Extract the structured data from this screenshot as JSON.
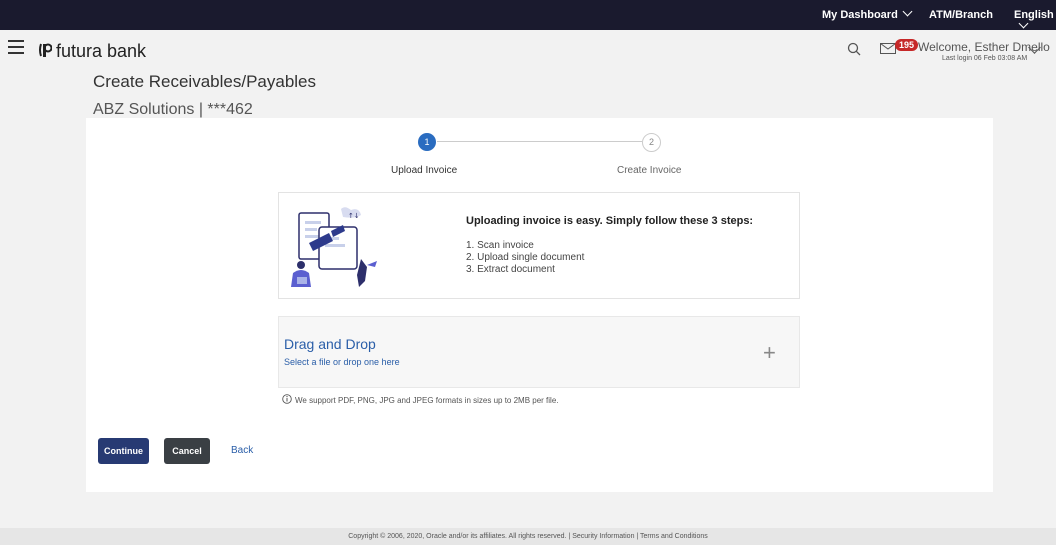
{
  "topbar": {
    "dashboard": "My Dashboard",
    "atm_branch": "ATM/Branch",
    "language": "English"
  },
  "header": {
    "brand": "futura bank",
    "notification_count": "195",
    "welcome": "Welcome, Esther Dmello",
    "last_login": "Last login 06 Feb 03:08 AM"
  },
  "page": {
    "title": "Create Receivables/Payables",
    "subtitle": "ABZ Solutions | ***462"
  },
  "stepper": {
    "steps": [
      {
        "number": "1",
        "label": "Upload Invoice",
        "active": true
      },
      {
        "number": "2",
        "label": "Create Invoice",
        "active": false
      }
    ]
  },
  "info": {
    "title": "Uploading invoice is easy. Simply follow these 3 steps:",
    "steps": [
      "1. Scan invoice",
      "2. Upload single document",
      "3. Extract document"
    ]
  },
  "dropzone": {
    "title": "Drag and Drop",
    "subtitle": "Select a file or drop one here",
    "plus": "+"
  },
  "support_note": "We support PDF, PNG, JPG and JPEG formats in sizes up to 2MB per file.",
  "actions": {
    "continue": "Continue",
    "cancel": "Cancel",
    "back": "Back"
  },
  "footer": "Copyright © 2006, 2020, Oracle and/or its affiliates. All rights reserved. | Security Information | Terms and Conditions",
  "colors": {
    "topbar": "#1a1a2e",
    "primary": "#273a73",
    "step_active": "#2a6cc0",
    "link": "#2a5ea8",
    "badge": "#c62828"
  },
  "icons": [
    "menu-icon",
    "bank-logo-icon",
    "search-icon",
    "mail-icon",
    "chevron-down-icon",
    "info-icon",
    "plus-icon"
  ]
}
